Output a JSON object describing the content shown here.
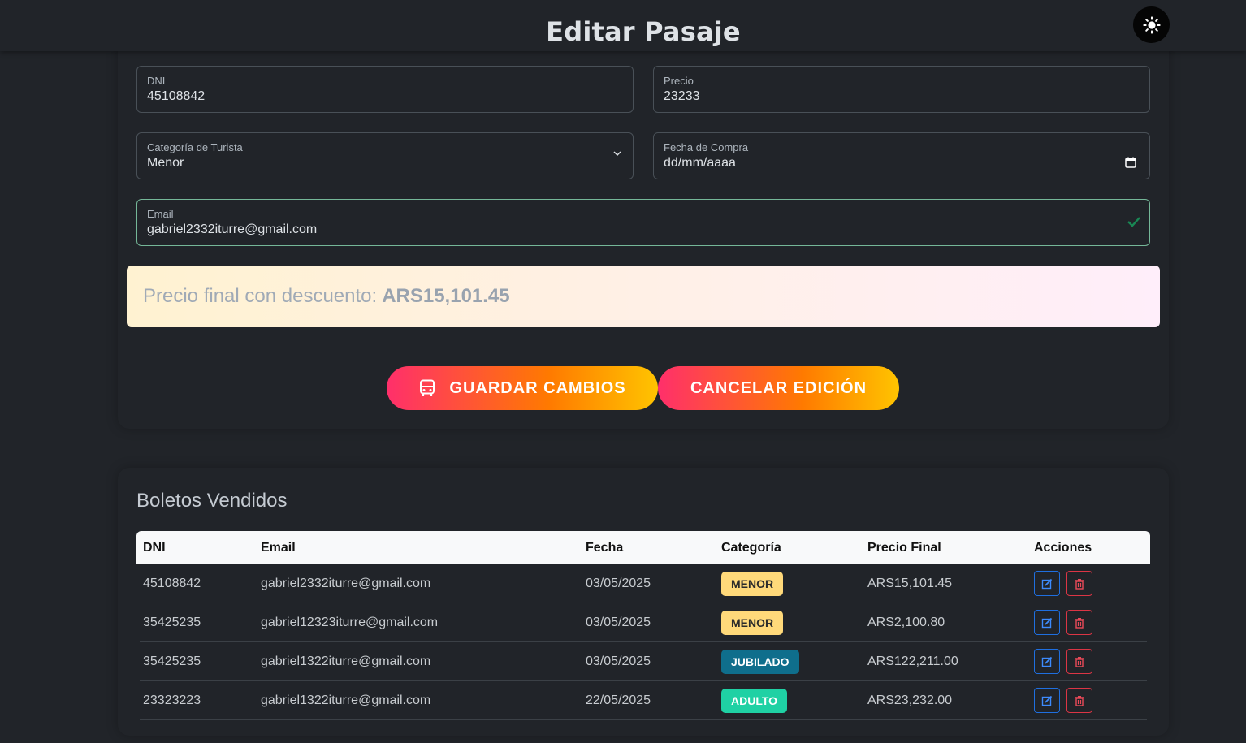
{
  "header": {
    "title": "Editar Pasaje",
    "theme_icon": "sun-icon"
  },
  "form": {
    "dni": {
      "label": "DNI",
      "value": "45108842"
    },
    "precio": {
      "label": "Precio",
      "value": "23233"
    },
    "categoria": {
      "label": "Categoría de Turista",
      "value": "Menor"
    },
    "fecha": {
      "label": "Fecha de Compra",
      "value": "dd/mm/aaaa"
    },
    "email": {
      "label": "Email",
      "value": "gabriel2332iturre@gmail.com"
    },
    "discount_label": "Precio final con descuento:",
    "discount_value": "ARS15,101.45",
    "save_label": "GUARDAR CAMBIOS",
    "cancel_label": "CANCELAR EDICIÓN"
  },
  "table": {
    "title": "Boletos Vendidos",
    "headers": [
      "DNI",
      "Email",
      "Fecha",
      "Categoría",
      "Precio Final",
      "Acciones"
    ],
    "rows": [
      {
        "dni": "45108842",
        "email": "gabriel2332iturre@gmail.com",
        "fecha": "03/05/2025",
        "categoria": "MENOR",
        "precio": "ARS15,101.45"
      },
      {
        "dni": "35425235",
        "email": "gabriel12323iturre@gmail.com",
        "fecha": "03/05/2025",
        "categoria": "MENOR",
        "precio": "ARS2,100.80"
      },
      {
        "dni": "35425235",
        "email": "gabriel1322iturre@gmail.com",
        "fecha": "03/05/2025",
        "categoria": "JUBILADO",
        "precio": "ARS122,211.00"
      },
      {
        "dni": "23323223",
        "email": "gabriel1322iturre@gmail.com",
        "fecha": "22/05/2025",
        "categoria": "ADULTO",
        "precio": "ARS23,232.00"
      }
    ]
  },
  "colors": {
    "background": "#212429",
    "gradient_start": "#ff2f6b",
    "gradient_end": "#ffc400",
    "edit": "#1f6fe0",
    "delete": "#dc3545",
    "badge_menor": "#ffd97a",
    "badge_jubilado": "#0f6e8c",
    "badge_adulto": "#1fd1a4"
  }
}
